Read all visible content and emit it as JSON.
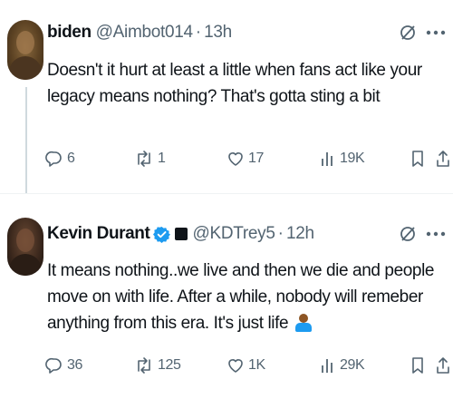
{
  "tweets": [
    {
      "author": {
        "name": "biden",
        "handle": "@Aimbot014",
        "time": "13h",
        "verified": false
      },
      "text": "Doesn't it hurt at least a little when fans act like your legacy means nothing? That's gotta sting a bit",
      "stats": {
        "replies": "6",
        "retweets": "1",
        "likes": "17",
        "views": "19K"
      }
    },
    {
      "author": {
        "name": "Kevin Durant",
        "handle": "@KDTrey5",
        "time": "12h",
        "verified": true
      },
      "text": "It means nothing..we live and then we die and people move on with life. After a while, nobody will remeber anything from this era. It's just life",
      "emoji": "person-shrugging-emoji",
      "stats": {
        "replies": "36",
        "retweets": "125",
        "likes": "1K",
        "views": "29K"
      }
    }
  ],
  "icons": {
    "reply": "reply-icon",
    "retweet": "retweet-icon",
    "like": "heart-icon",
    "views": "views-icon",
    "bookmark": "bookmark-icon",
    "share": "share-icon",
    "grok": "grok-icon",
    "more": "more-icon"
  },
  "colors": {
    "text": "#0f1419",
    "secondary": "#536471",
    "verified": "#1d9bf0",
    "divider": "#eff3f4",
    "thread_line": "#cfd9de"
  }
}
